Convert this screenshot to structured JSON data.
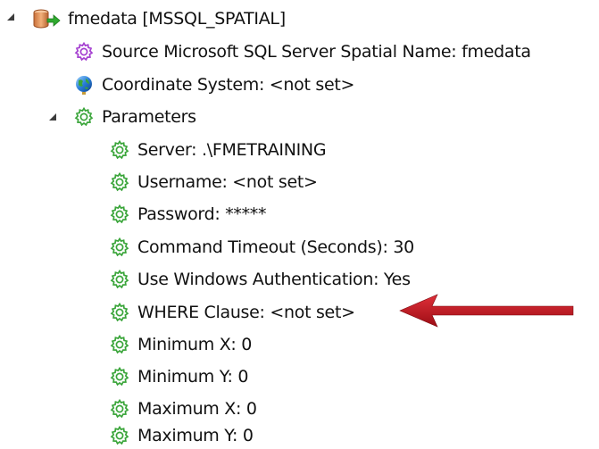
{
  "tree": {
    "root": {
      "label": "fmedata [MSSQL_SPATIAL]",
      "icon": "database-reader-icon",
      "expanded": true
    },
    "root_children": [
      {
        "label": "Source Microsoft SQL Server Spatial Name: fmedata",
        "icon": "purple-gear-icon"
      },
      {
        "label": "Coordinate System: <not set>",
        "icon": "globe-icon"
      }
    ],
    "parameters": {
      "label": "Parameters",
      "icon": "green-gear-icon",
      "expanded": true,
      "items": [
        {
          "label": "Server: .\\FMETRAINING"
        },
        {
          "label": "Username: <not set>"
        },
        {
          "label": "Password: *****"
        },
        {
          "label": "Command Timeout (Seconds): 30"
        },
        {
          "label": "Use Windows Authentication: Yes"
        },
        {
          "label": "WHERE Clause: <not set>"
        },
        {
          "label": "Minimum X: 0"
        },
        {
          "label": "Minimum Y: 0"
        },
        {
          "label": "Maximum X: 0"
        },
        {
          "label": "Maximum Y: 0"
        }
      ]
    }
  },
  "annotation": {
    "icon": "red-arrow-icon",
    "points_to": "WHERE Clause: <not set>",
    "color": "#c0141c"
  },
  "colors": {
    "purple_gear": "#a43ed0",
    "green_gear": "#3aa53a",
    "arrow": "#c0141c"
  }
}
